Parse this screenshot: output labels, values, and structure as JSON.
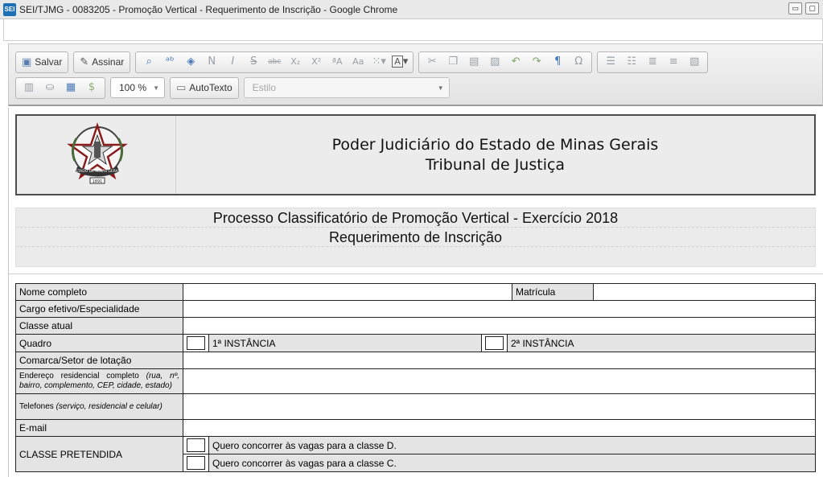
{
  "window": {
    "app_icon": "SEI",
    "title": "SEI/TJMG - 0083205 - Promoção Vertical - Requerimento de Inscrição - Google Chrome"
  },
  "toolbar": {
    "save_label": "Salvar",
    "sign_label": "Assinar",
    "zoom_value": "100 %",
    "autotext_label": "AutoTexto",
    "style_placeholder": "Estilo",
    "format_icons": [
      "find-icon",
      "replace-icon",
      "eraser-icon",
      "bold-icon",
      "italic-icon",
      "strikethrough-icon",
      "strike-abc-icon",
      "subscript-icon",
      "superscript-icon",
      "uppercase-icon",
      "lowercase-icon",
      "table-icon",
      "text-color-icon",
      "cut-icon",
      "copy-icon",
      "paste-icon",
      "paste-text-icon",
      "undo-icon",
      "redo-icon",
      "pilcrow-icon",
      "omega-icon",
      "numbered-list-icon",
      "bullet-list-icon",
      "outdent-icon",
      "indent-icon",
      "image-icon"
    ],
    "icon_glyphs": {
      "bold": "N",
      "italic": "I",
      "strike": "S",
      "abc": "abc",
      "sub": "X₂",
      "sup": "X²",
      "pilcrow": "¶",
      "omega": "Ω",
      "font_color": "A",
      "dollar": "$"
    }
  },
  "document": {
    "seal_text_top": "ESTADO DE MINAS GERAIS",
    "seal_text_bottom": "1891",
    "court_name": "Poder Judiciário do Estado de Minas Gerais",
    "court_subname": "Tribunal de Justiça",
    "process_title": "Processo Classificatório de Promoção Vertical - Exercício 2018",
    "document_title": "Requerimento de Inscrição",
    "form": {
      "full_name_label": "Nome completo",
      "registration_label": "Matrícula",
      "position_label": "Cargo efetivo/Especialidade",
      "current_class_label": "Classe atual",
      "board_label": "Quadro",
      "first_instance": "1ª INSTÂNCIA",
      "second_instance": "2ª INSTÂNCIA",
      "district_label": "Comarca/Setor de lotação",
      "address_label_main": "Endereço residencial completo",
      "address_label_detail": "(rua, nº, bairro, complemento, CEP, cidade, estado)",
      "phones_label_main": "Telefones",
      "phones_label_detail": "(serviço, residencial e celular)",
      "email_label": "E-mail",
      "desired_class_label": "CLASSE PRETENDIDA",
      "class_d_option": "Quero concorrer às vagas para a classe D.",
      "class_c_option": "Quero concorrer às vagas para a classe C."
    }
  }
}
